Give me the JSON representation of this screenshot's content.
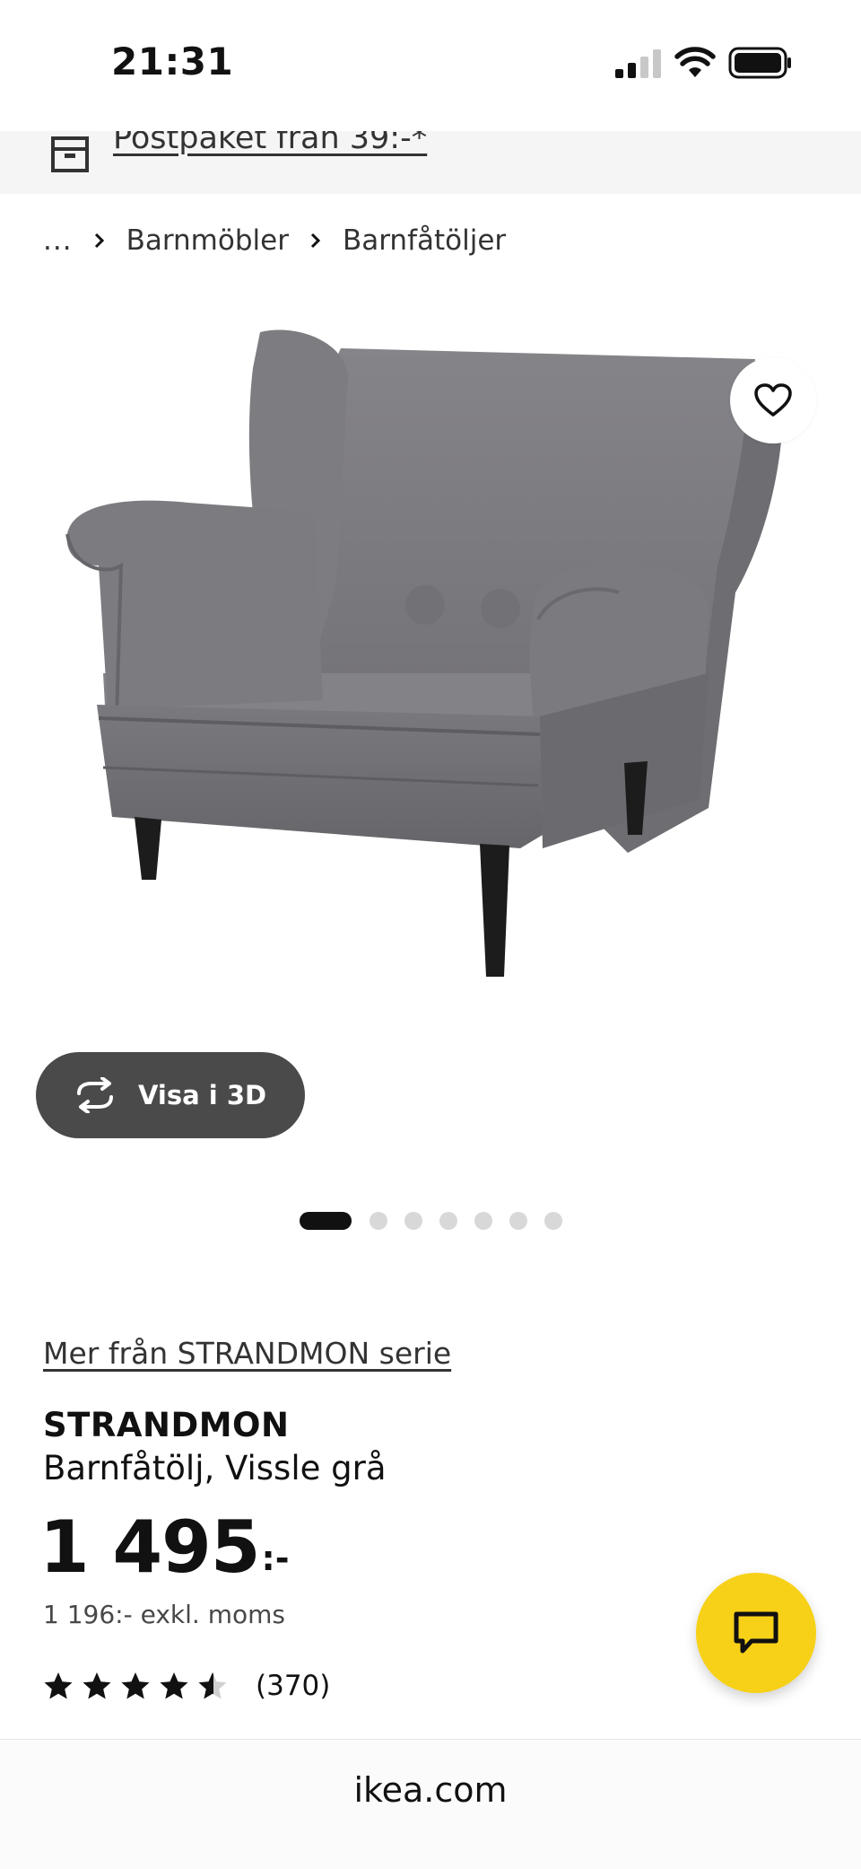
{
  "status_bar": {
    "time": "21:31"
  },
  "promo": {
    "text": "Postpaket från 39:-*",
    "icon": "package-icon"
  },
  "breadcrumb": {
    "ellipsis": "...",
    "items": [
      "Barnmöbler",
      "Barnfåtöljer"
    ]
  },
  "product_image": {
    "fabric_color": "#7b7a7f",
    "legs_color": "#1c1c1c"
  },
  "view_3d": {
    "label": "Visa i 3D",
    "icon": "rotate-3d-icon"
  },
  "favorite": {
    "icon": "heart-icon"
  },
  "carousel": {
    "count": 7,
    "active_index": 0
  },
  "product": {
    "series_link": "Mer från STRANDMON serie",
    "name": "STRANDMON",
    "description": "Barnfåtölj, Vissle grå",
    "price_main": "1 495",
    "price_suffix": ":-",
    "price_excl": "1 196:- exkl. moms",
    "rating_value": 4.5,
    "rating_max": 5,
    "rating_count": "(370)"
  },
  "chat": {
    "icon": "chat-icon",
    "color": "#f7d117"
  },
  "url_bar": {
    "url": "ikea.com"
  }
}
